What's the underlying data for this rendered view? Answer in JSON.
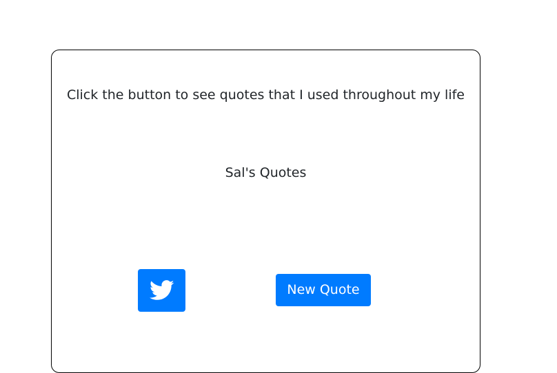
{
  "card": {
    "instructions": "Click the button to see quotes that I used throughout my life",
    "quote_text": "Sal's Quotes"
  },
  "buttons": {
    "tweet_icon": "twitter-bird-icon",
    "new_quote_label": "New Quote"
  },
  "colors": {
    "primary": "#007bff",
    "text": "#212529",
    "border": "#000000"
  }
}
